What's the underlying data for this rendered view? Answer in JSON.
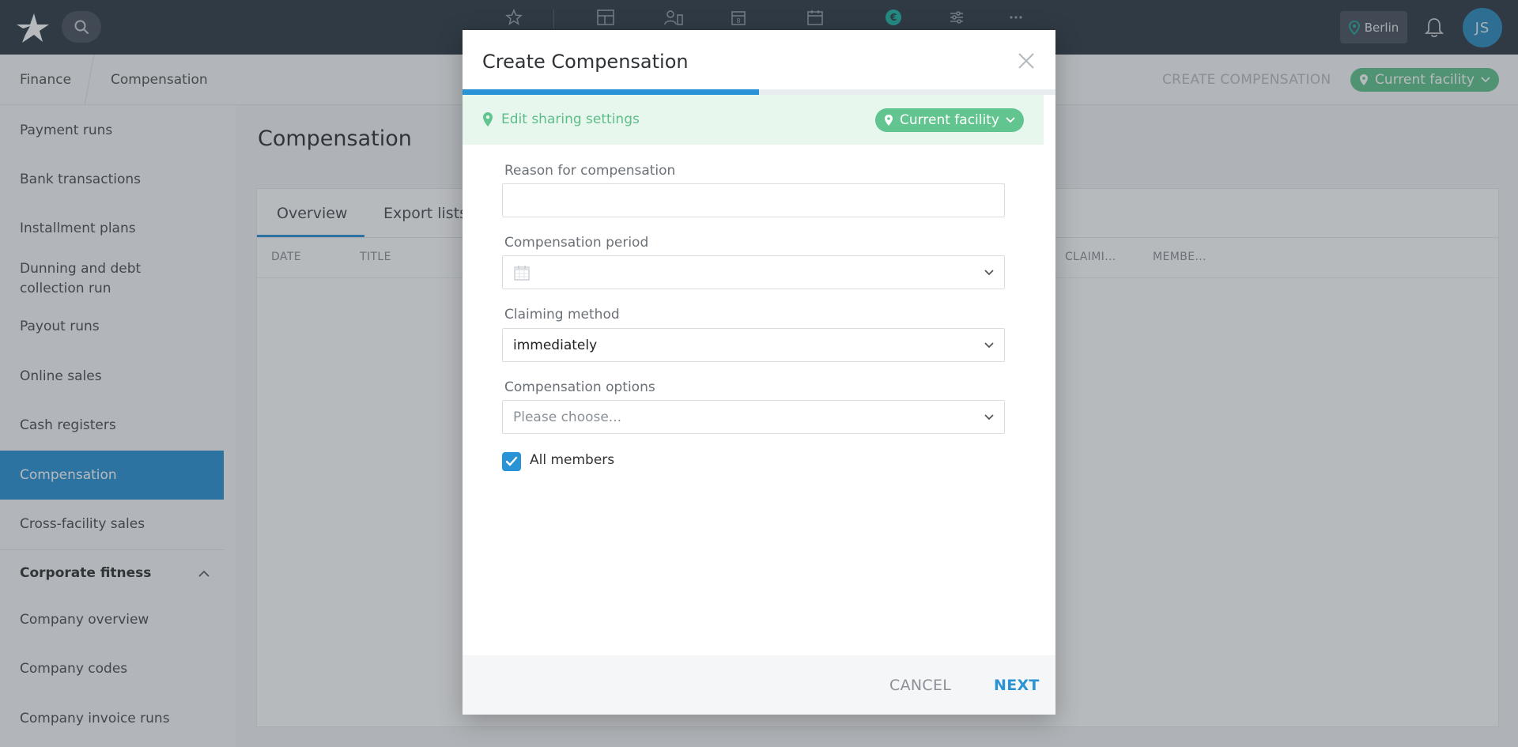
{
  "topbar": {
    "location_label": "Berlin",
    "avatar_initials": "JS",
    "icons": [
      "star-icon",
      "dashboard-icon",
      "members-icon",
      "schedule-icon",
      "calendar-icon",
      "finance-icon",
      "settings-sliders-icon",
      "more-icon"
    ]
  },
  "breadcrumb": {
    "items": [
      "Finance",
      "Compensation"
    ],
    "action_label": "CREATE COMPENSATION",
    "facility_label": "Current facility"
  },
  "sidebar": {
    "items": [
      {
        "label": "Payment runs"
      },
      {
        "label": "Bank transactions"
      },
      {
        "label": "Installment plans"
      },
      {
        "label": "Dunning and debt collection run"
      },
      {
        "label": "Payout runs"
      },
      {
        "label": "Online sales"
      },
      {
        "label": "Cash registers"
      },
      {
        "label": "Compensation",
        "active": true
      },
      {
        "label": "Cross-facility sales"
      }
    ],
    "section_label": "Corporate fitness",
    "section_items": [
      {
        "label": "Company overview"
      },
      {
        "label": "Company codes"
      },
      {
        "label": "Company invoice runs"
      }
    ]
  },
  "main": {
    "title": "Compensation",
    "tabs": [
      "Overview",
      "Export lists"
    ],
    "columns": [
      "DATE",
      "TITLE",
      "CLAIMI...",
      "MEMBE..."
    ]
  },
  "modal": {
    "title": "Create Compensation",
    "progress_fraction": 0.5,
    "sharing_label": "Edit sharing settings",
    "sharing_facility": "Current facility",
    "fields": {
      "reason_label": "Reason for compensation",
      "reason_value": "",
      "period_label": "Compensation period",
      "claiming_label": "Claiming method",
      "claiming_value": "immediately",
      "options_label": "Compensation options",
      "options_placeholder": "Please choose..."
    },
    "all_members_label": "All members",
    "all_members_checked": true,
    "cancel_label": "CANCEL",
    "next_label": "NEXT"
  },
  "colors": {
    "topbar": "#303b45",
    "accent_blue": "#2a93d5",
    "facility_green": "#62c48e",
    "share_bg": "#e7f7ee"
  }
}
